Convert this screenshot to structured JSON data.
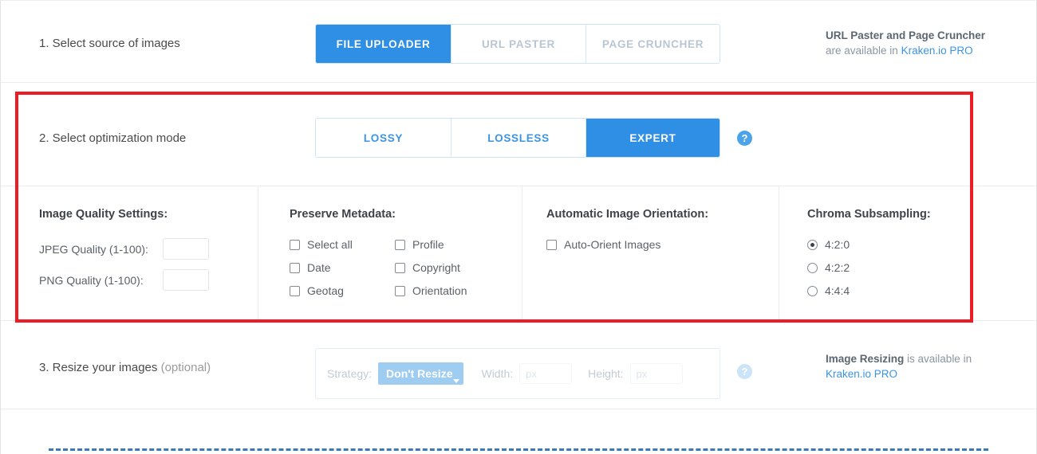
{
  "sections": {
    "source": {
      "label": "1. Select source of images",
      "tabs": [
        {
          "label": "FILE UPLOADER",
          "state": "active"
        },
        {
          "label": "URL PASTER",
          "state": "disabled"
        },
        {
          "label": "PAGE CRUNCHER",
          "state": "disabled"
        }
      ],
      "note": {
        "line1": "URL Paster and Page Cruncher",
        "line2_prefix": "are available in ",
        "link": "Kraken.io PRO"
      }
    },
    "mode": {
      "label": "2. Select optimization mode",
      "tabs": [
        {
          "label": "LOSSY",
          "state": "idle"
        },
        {
          "label": "LOSSLESS",
          "state": "idle"
        },
        {
          "label": "EXPERT",
          "state": "active"
        }
      ],
      "help_icon": "question-mark-icon"
    },
    "expert": {
      "quality": {
        "title": "Image Quality Settings:",
        "fields": [
          {
            "label": "JPEG Quality (1-100):",
            "value": "",
            "placeholder": ""
          },
          {
            "label": "PNG Quality (1-100):",
            "value": "",
            "placeholder": ""
          }
        ]
      },
      "metadata": {
        "title": "Preserve Metadata:",
        "options": [
          {
            "label": "Select all",
            "checked": false
          },
          {
            "label": "Profile",
            "checked": false
          },
          {
            "label": "Date",
            "checked": false
          },
          {
            "label": "Copyright",
            "checked": false
          },
          {
            "label": "Geotag",
            "checked": false
          },
          {
            "label": "Orientation",
            "checked": false
          }
        ]
      },
      "orientation": {
        "title": "Automatic Image Orientation:",
        "options": [
          {
            "label": "Auto-Orient Images",
            "checked": false
          }
        ]
      },
      "chroma": {
        "title": "Chroma Subsampling:",
        "options": [
          {
            "label": "4:2:0",
            "checked": true
          },
          {
            "label": "4:2:2",
            "checked": false
          },
          {
            "label": "4:4:4",
            "checked": false
          }
        ]
      }
    },
    "resize": {
      "label_main": "3. Resize your images ",
      "label_optional": "(optional)",
      "strategy_label": "Strategy:",
      "strategy_value": "Don't Resize",
      "width_label": "Width:",
      "width_value": "",
      "width_placeholder": "px",
      "height_label": "Height:",
      "height_value": "",
      "height_placeholder": "px",
      "help_icon": "question-mark-icon",
      "note": {
        "strong": "Image Resizing",
        "rest": " is available in",
        "link": "Kraken.io PRO"
      }
    }
  },
  "annotation": {
    "highlight_color": "#ed1c24",
    "help_glyph": "?"
  },
  "colors": {
    "accent_blue": "#2f8fe5",
    "link_blue": "#3b94e4",
    "muted_gray": "#9b9b9b"
  }
}
